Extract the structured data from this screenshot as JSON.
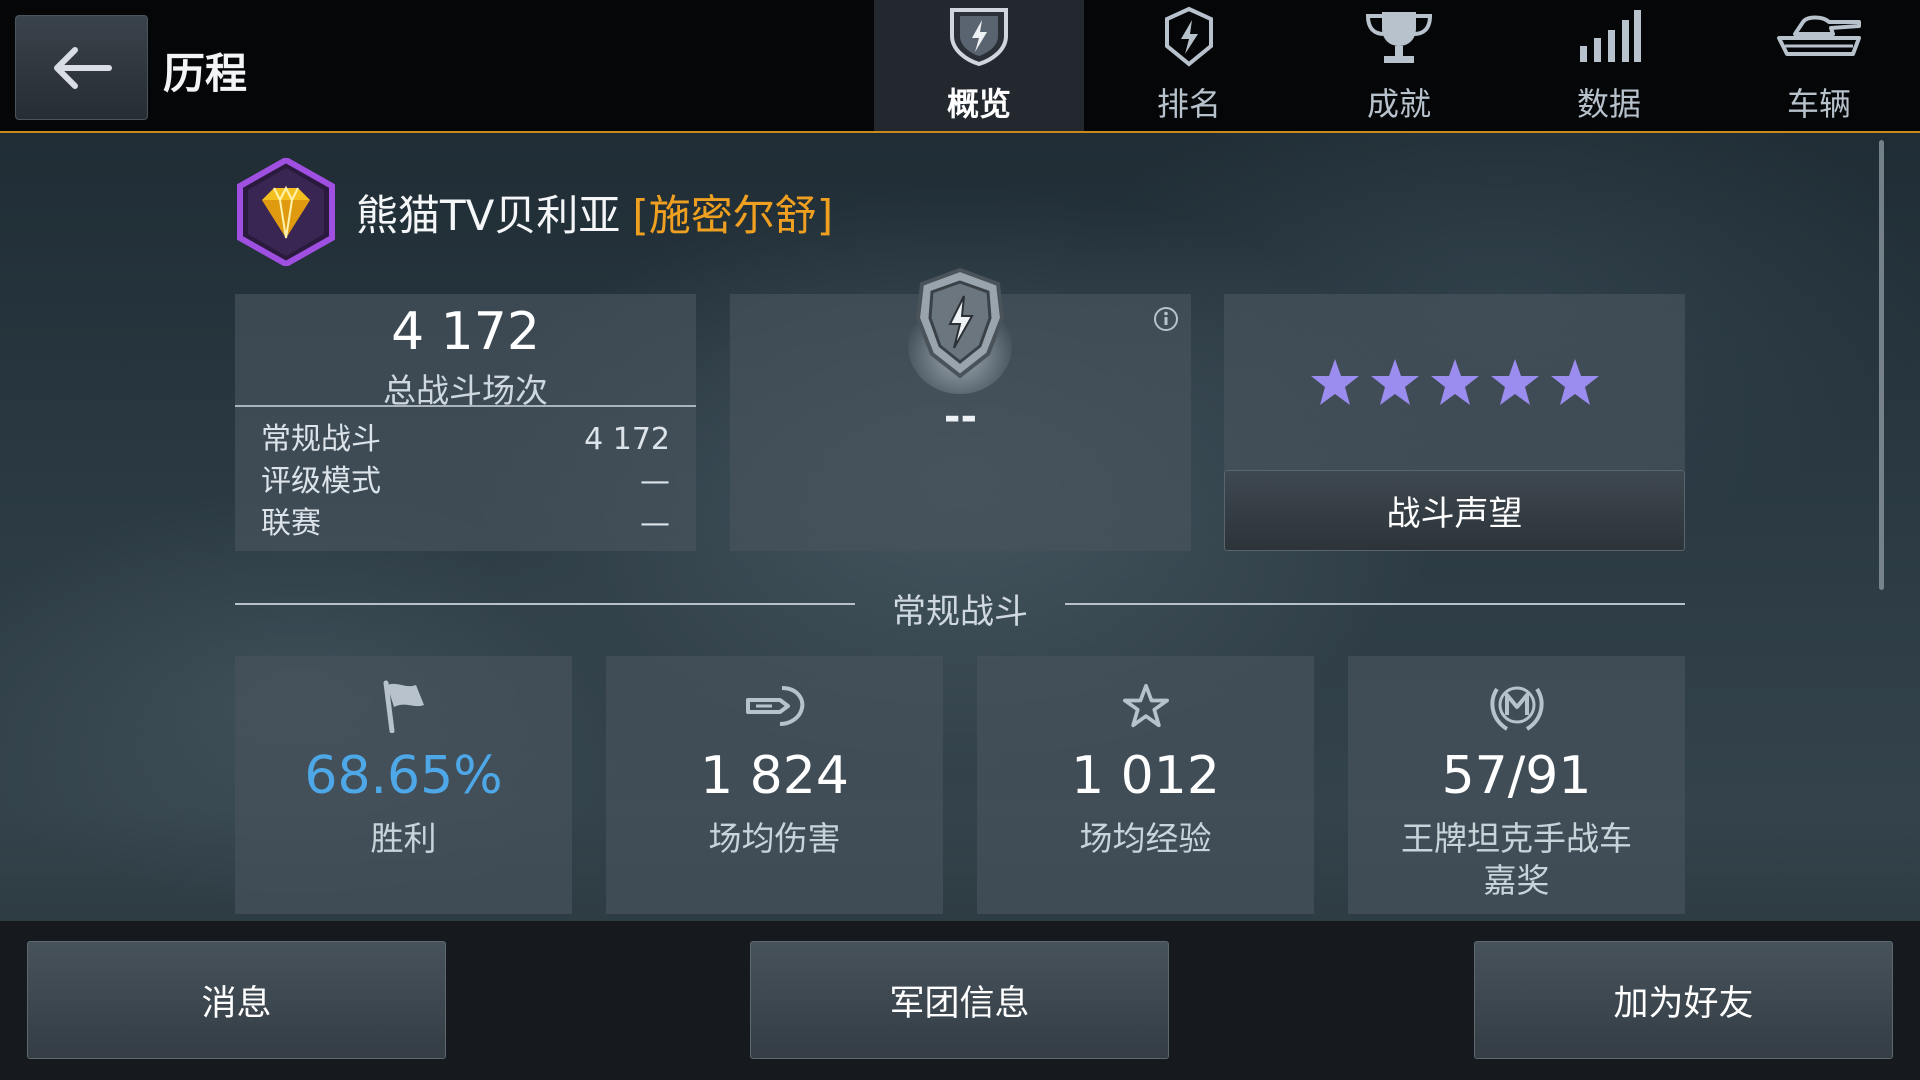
{
  "header": {
    "title": "历程",
    "tabs": [
      {
        "label": "概览",
        "icon": "overview-shield-icon",
        "active": true
      },
      {
        "label": "排名",
        "icon": "ranking-badge-icon",
        "active": false
      },
      {
        "label": "成就",
        "icon": "trophy-icon",
        "active": false
      },
      {
        "label": "数据",
        "icon": "bar-chart-icon",
        "active": false
      },
      {
        "label": "车辆",
        "icon": "tank-icon",
        "active": false
      }
    ]
  },
  "player": {
    "name": "熊猫TV贝利亚",
    "clan": "[施密尔舒]",
    "rank_icon": "diamond-rank-icon"
  },
  "battles": {
    "total": "4 172",
    "total_label": "总战斗场次",
    "rows": [
      {
        "label": "常规战斗",
        "value": "4 172"
      },
      {
        "label": "评级模式",
        "value": "—"
      },
      {
        "label": "联赛",
        "value": "—"
      }
    ]
  },
  "rating": {
    "value": "--",
    "icon": "rating-shield-icon"
  },
  "reputation": {
    "stars": 5,
    "button_label": "战斗声望",
    "star_color": "#9b8cf0"
  },
  "section": {
    "title": "常规战斗"
  },
  "stats": [
    {
      "value": "68.65%",
      "label": "胜利",
      "icon": "flag-icon"
    },
    {
      "value": "1 824",
      "label": "场均伤害",
      "icon": "shell-icon"
    },
    {
      "value": "1 012",
      "label": "场均经验",
      "icon": "star-icon"
    },
    {
      "value": "57/91",
      "label": "王牌坦克手战车嘉奖",
      "label_line1": "王牌坦克手战车",
      "label_line2": "嘉奖",
      "icon": "mastery-badge-icon"
    }
  ],
  "footer": {
    "message_label": "消息",
    "clan_label": "军团信息",
    "add_friend_label": "加为好友"
  },
  "colors": {
    "accent": "#c98a1c",
    "win_rate": "#4ea8e8",
    "clan_tag": "#f0a020"
  }
}
